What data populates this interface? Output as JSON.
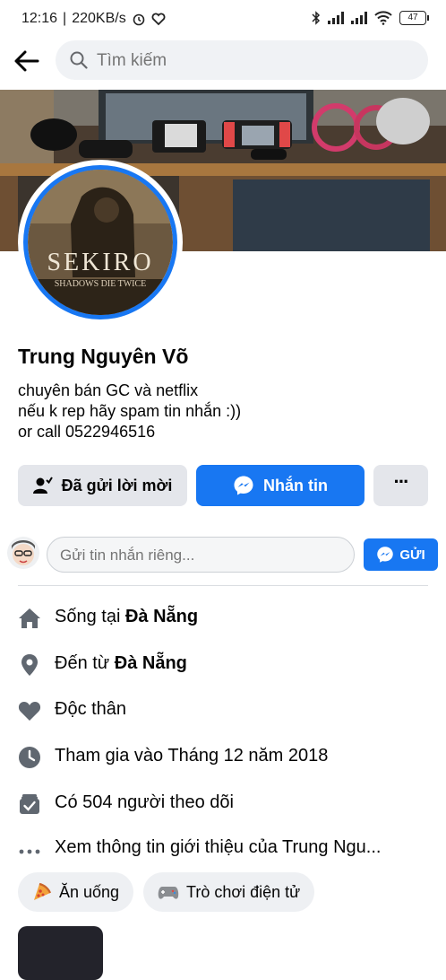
{
  "status_bar": {
    "time": "12:16",
    "speed": "220KB/s",
    "battery": "47"
  },
  "search": {
    "placeholder": "Tìm kiếm"
  },
  "profile": {
    "name": "Trung Nguyên Võ",
    "avatar_text": "SEKIRO",
    "avatar_subtext": "SHADOWS DIE TWICE",
    "bio_lines": [
      "chuyên bán GC và netflix",
      "nếu k rep hãy spam tin nhắn :))",
      "or call 0522946516"
    ]
  },
  "actions": {
    "friend_request": "Đã gửi lời mời",
    "message": "Nhắn tin",
    "more": "···"
  },
  "private_message": {
    "placeholder": "Gửi tin nhắn riêng...",
    "send": "GỬI"
  },
  "details": [
    {
      "icon": "home-icon",
      "prefix": "Sống tại ",
      "bold": "Đà Nẵng"
    },
    {
      "icon": "location-pin-icon",
      "prefix": "Đến từ ",
      "bold": "Đà Nẵng"
    },
    {
      "icon": "heart-icon",
      "prefix": "Độc thân",
      "bold": ""
    },
    {
      "icon": "clock-icon",
      "prefix": "Tham gia vào Tháng 12 năm 2018",
      "bold": ""
    },
    {
      "icon": "followers-icon",
      "prefix": "Có 504 người theo dõi",
      "bold": ""
    },
    {
      "icon": "more-dots-icon",
      "prefix": "Xem thông tin giới thiệu của Trung Ngu...",
      "bold": ""
    }
  ],
  "interests": [
    {
      "icon": "pizza-icon",
      "label": "Ăn uống"
    },
    {
      "icon": "gamepad-icon",
      "label": "Trò chơi điện tử"
    }
  ],
  "colors": {
    "accent": "#1877f2",
    "button_gray": "#e4e6eb",
    "icon_gray": "#606770"
  }
}
